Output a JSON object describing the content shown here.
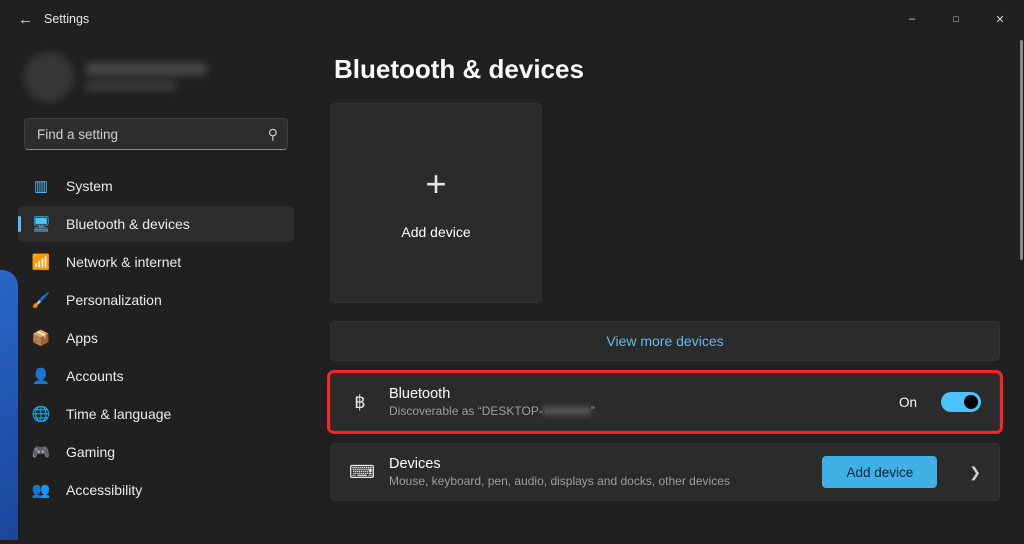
{
  "app": {
    "title": "Settings"
  },
  "search": {
    "placeholder": "Find a setting"
  },
  "sidebar": {
    "items": [
      {
        "label": "System"
      },
      {
        "label": "Bluetooth & devices"
      },
      {
        "label": "Network & internet"
      },
      {
        "label": "Personalization"
      },
      {
        "label": "Apps"
      },
      {
        "label": "Accounts"
      },
      {
        "label": "Time & language"
      },
      {
        "label": "Gaming"
      },
      {
        "label": "Accessibility"
      }
    ],
    "active_index": 1
  },
  "page": {
    "title": "Bluetooth & devices",
    "add_device": "Add device",
    "view_more": "View more devices",
    "bluetooth": {
      "title": "Bluetooth",
      "desc_prefix": "Discoverable as “DESKTOP-",
      "desc_obscured": "XXXXXX",
      "state": "On"
    },
    "devices": {
      "title": "Devices",
      "desc": "Mouse, keyboard, pen, audio, displays and docks, other devices",
      "button": "Add device"
    }
  },
  "colors": {
    "accent": "#4cc2ff"
  }
}
